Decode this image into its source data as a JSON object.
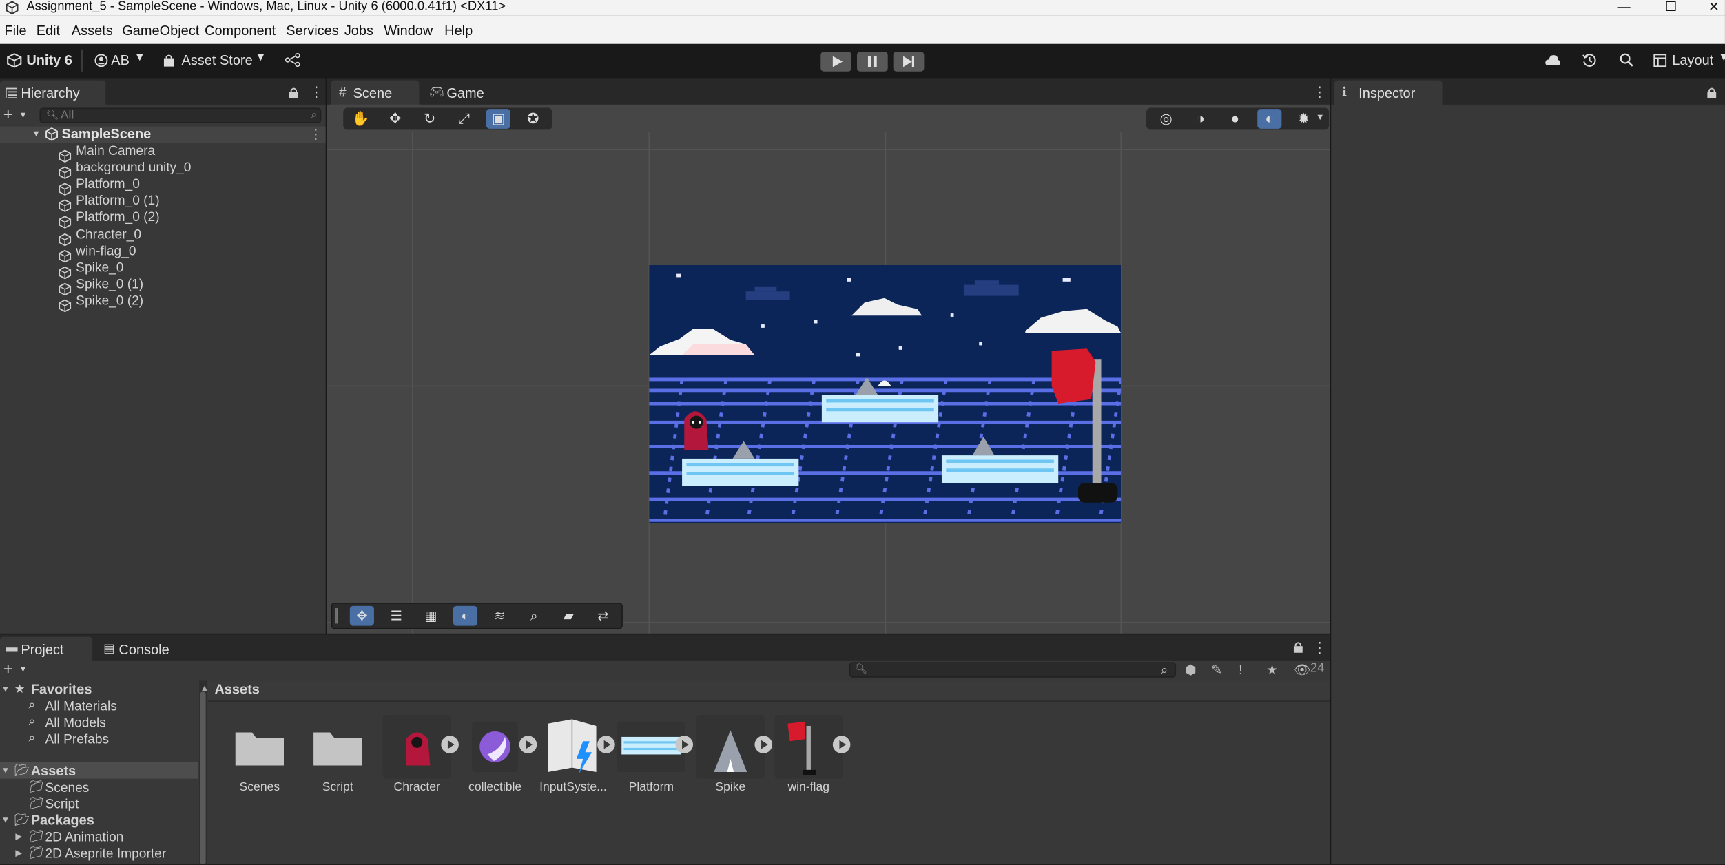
{
  "window": {
    "title": "Assignment_5 - SampleScene - Windows, Mac, Linux - Unity 6 (6000.0.41f1) <DX11>",
    "minimize": "—",
    "maximize": "☐",
    "close": "✕"
  },
  "menu": [
    "File",
    "Edit",
    "Assets",
    "GameObject",
    "Component",
    "Services",
    "Jobs",
    "Window",
    "Help"
  ],
  "toolbar": {
    "product": "Unity 6",
    "account": "AB",
    "asset_store": "Asset Store",
    "layout": "Layout"
  },
  "hierarchy": {
    "tab": "Hierarchy",
    "search_placeholder": "All",
    "scene": "SampleScene",
    "items": [
      "Main Camera",
      "background unity_0",
      "Platform_0",
      "Platform_0 (1)",
      "Platform_0 (2)",
      "Chracter_0",
      "win-flag_0",
      "Spike_0",
      "Spike_0 (1)",
      "Spike_0 (2)"
    ]
  },
  "scene_view": {
    "tab_scene": "Scene",
    "tab_game": "Game"
  },
  "inspector": {
    "tab": "Inspector"
  },
  "project": {
    "tab_project": "Project",
    "tab_console": "Console",
    "hidden_count": "24",
    "favorites": {
      "label": "Favorites",
      "items": [
        "All Materials",
        "All Models",
        "All Prefabs"
      ]
    },
    "assets_tree": {
      "label": "Assets",
      "items": [
        "Scenes",
        "Script"
      ]
    },
    "packages": {
      "label": "Packages",
      "items": [
        "2D Animation",
        "2D Aseprite Importer"
      ]
    },
    "breadcrumb": "Assets",
    "assets": [
      "Scenes",
      "Script",
      "Chracter",
      "collectible",
      "InputSyste...",
      "Platform",
      "Spike",
      "win-flag"
    ]
  },
  "colors": {
    "accent": "#4a6fa5",
    "panel": "#383838",
    "toolbar": "#191919"
  }
}
